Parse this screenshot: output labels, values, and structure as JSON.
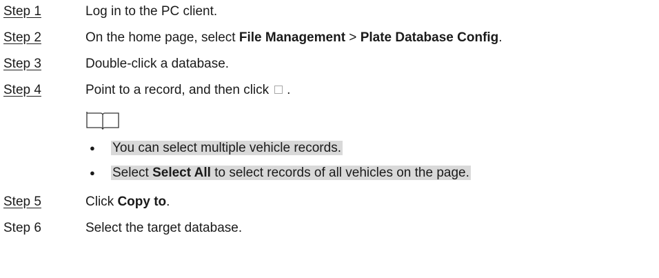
{
  "steps": [
    {
      "label": "Step 1",
      "text": "Log in to the PC client.",
      "linked": true
    },
    {
      "label": "Step 2",
      "text_pre": "On the home page, select ",
      "bold1": "File Management",
      "mid": " > ",
      "bold2": "Plate Database Config",
      "post": ".",
      "linked": true
    },
    {
      "label": "Step 3",
      "text": "Double-click a database.",
      "linked": true
    },
    {
      "label": "Step 4",
      "text_pre": "Point to a record, and then click",
      "post": ".",
      "icon": "checkbox-icon",
      "linked": true
    },
    {
      "label": "Step 5",
      "text_pre": "Click ",
      "bold1": "Copy to",
      "post": ".",
      "linked": true
    },
    {
      "label": "Step 6",
      "text": "Select the target database.",
      "linked": false
    }
  ],
  "note": {
    "icon": "book-icon",
    "bullets": [
      {
        "text": "You can select multiple vehicle records."
      },
      {
        "pre": "Select ",
        "bold": "Select All",
        "post": " to select records of all vehicles on the page."
      }
    ]
  }
}
